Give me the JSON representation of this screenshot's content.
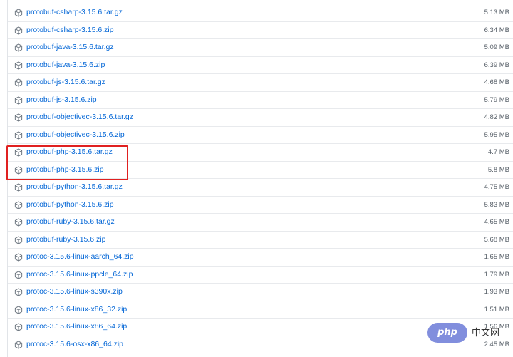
{
  "colors": {
    "link": "#0366d6",
    "size_text": "#586069",
    "icon": "#6a737d",
    "highlight": "#e02020",
    "row_border": "#e8eaed"
  },
  "row_icon": "package-icon",
  "assets": [
    {
      "name": "protobuf-csharp-3.15.6.tar.gz",
      "size": "5.13 MB"
    },
    {
      "name": "protobuf-csharp-3.15.6.zip",
      "size": "6.34 MB"
    },
    {
      "name": "protobuf-java-3.15.6.tar.gz",
      "size": "5.09 MB"
    },
    {
      "name": "protobuf-java-3.15.6.zip",
      "size": "6.39 MB"
    },
    {
      "name": "protobuf-js-3.15.6.tar.gz",
      "size": "4.68 MB"
    },
    {
      "name": "protobuf-js-3.15.6.zip",
      "size": "5.79 MB"
    },
    {
      "name": "protobuf-objectivec-3.15.6.tar.gz",
      "size": "4.82 MB"
    },
    {
      "name": "protobuf-objectivec-3.15.6.zip",
      "size": "5.95 MB"
    },
    {
      "name": "protobuf-php-3.15.6.tar.gz",
      "size": "4.7 MB"
    },
    {
      "name": "protobuf-php-3.15.6.zip",
      "size": "5.8 MB"
    },
    {
      "name": "protobuf-python-3.15.6.tar.gz",
      "size": "4.75 MB"
    },
    {
      "name": "protobuf-python-3.15.6.zip",
      "size": "5.83 MB"
    },
    {
      "name": "protobuf-ruby-3.15.6.tar.gz",
      "size": "4.65 MB"
    },
    {
      "name": "protobuf-ruby-3.15.6.zip",
      "size": "5.68 MB"
    },
    {
      "name": "protoc-3.15.6-linux-aarch_64.zip",
      "size": "1.65 MB"
    },
    {
      "name": "protoc-3.15.6-linux-ppcle_64.zip",
      "size": "1.79 MB"
    },
    {
      "name": "protoc-3.15.6-linux-s390x.zip",
      "size": "1.93 MB"
    },
    {
      "name": "protoc-3.15.6-linux-x86_32.zip",
      "size": "1.51 MB"
    },
    {
      "name": "protoc-3.15.6-linux-x86_64.zip",
      "size": "1.56 MB"
    },
    {
      "name": "protoc-3.15.6-osx-x86_64.zip",
      "size": "2.45 MB"
    }
  ],
  "highlighted_assets": [
    8,
    9
  ],
  "watermark": {
    "logo_text": "php",
    "text": "中文网"
  }
}
